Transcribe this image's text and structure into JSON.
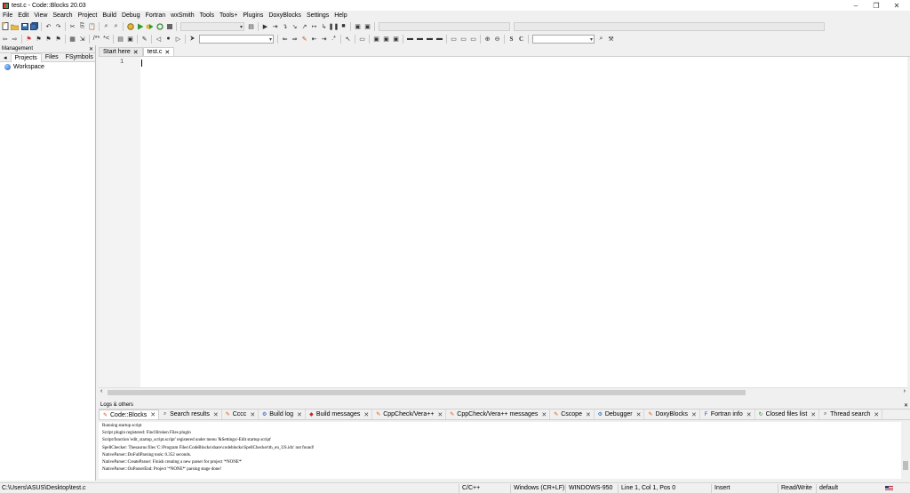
{
  "window": {
    "title": "test.c - Code::Blocks 20.03",
    "minimize": "–",
    "restore": "❐",
    "close": "✕"
  },
  "menu": [
    "File",
    "Edit",
    "View",
    "Search",
    "Project",
    "Build",
    "Debug",
    "Fortran",
    "wxSmith",
    "Tools",
    "Tools+",
    "Plugins",
    "DoxyBlocks",
    "Settings",
    "Help"
  ],
  "management": {
    "title": "Management",
    "close": "✕",
    "tabs": [
      "Projects",
      "Files",
      "FSymbols"
    ],
    "nav_left": "◂",
    "nav_right": "▸",
    "tree_root": "Workspace"
  },
  "editor": {
    "tabs": [
      {
        "label": "Start here",
        "close": "✕"
      },
      {
        "label": "test.c",
        "close": "✕"
      }
    ],
    "line_numbers": [
      "1"
    ]
  },
  "logs": {
    "title": "Logs & others",
    "close": "✕",
    "tabs": [
      {
        "label": "Code::Blocks",
        "icon": "✎",
        "color": "#d35400"
      },
      {
        "label": "Search results",
        "icon": "⌕",
        "color": "#333"
      },
      {
        "label": "Cccc",
        "icon": "✎",
        "color": "#d35400"
      },
      {
        "label": "Build log",
        "icon": "⚙",
        "color": "#1e5fbf"
      },
      {
        "label": "Build messages",
        "icon": "◆",
        "color": "#c62828"
      },
      {
        "label": "CppCheck/Vera++",
        "icon": "✎",
        "color": "#d35400"
      },
      {
        "label": "CppCheck/Vera++ messages",
        "icon": "✎",
        "color": "#d35400"
      },
      {
        "label": "Cscope",
        "icon": "✎",
        "color": "#d35400"
      },
      {
        "label": "Debugger",
        "icon": "⚙",
        "color": "#1e5fbf"
      },
      {
        "label": "DoxyBlocks",
        "icon": "✎",
        "color": "#d35400"
      },
      {
        "label": "Fortran info",
        "icon": "F",
        "color": "#1e5fbf"
      },
      {
        "label": "Closed files list",
        "icon": "↻",
        "color": "#2e7d32"
      },
      {
        "label": "Thread search",
        "icon": "⌕",
        "color": "#333"
      }
    ],
    "lines": [
      "Running startup script",
      "Script plugin registered: Find Broken Files plugin",
      "Script/function 'edit_startup_script.script' registered under menu '&Settings/-Edit startup script'",
      "SpellChecker: Thesaurus files 'C:\\Program Files\\CodeBlocks\\share\\codeblocks\\SpellChecker\\th_en_US.idx' not found!",
      "NativeParser::DoFullParsing took: 0.352 seconds.",
      "NativeParser::CreateParser: Finish creating a new parser for project '*NONE*'",
      "NativeParser::OnParserEnd: Project '*NONE*' parsing stage done!"
    ]
  },
  "status": {
    "path": "C:\\Users\\ASUS\\Desktop\\test.c",
    "language": "C/C++",
    "eol": "Windows (CR+LF)",
    "encoding": "WINDOWS-950",
    "position": "Line 1, Col 1, Pos 0",
    "mode": "Insert",
    "access": "Read/Write",
    "profile": "default"
  },
  "toolbar_labels": {
    "bold_s": "S",
    "c_glyph": "C"
  }
}
